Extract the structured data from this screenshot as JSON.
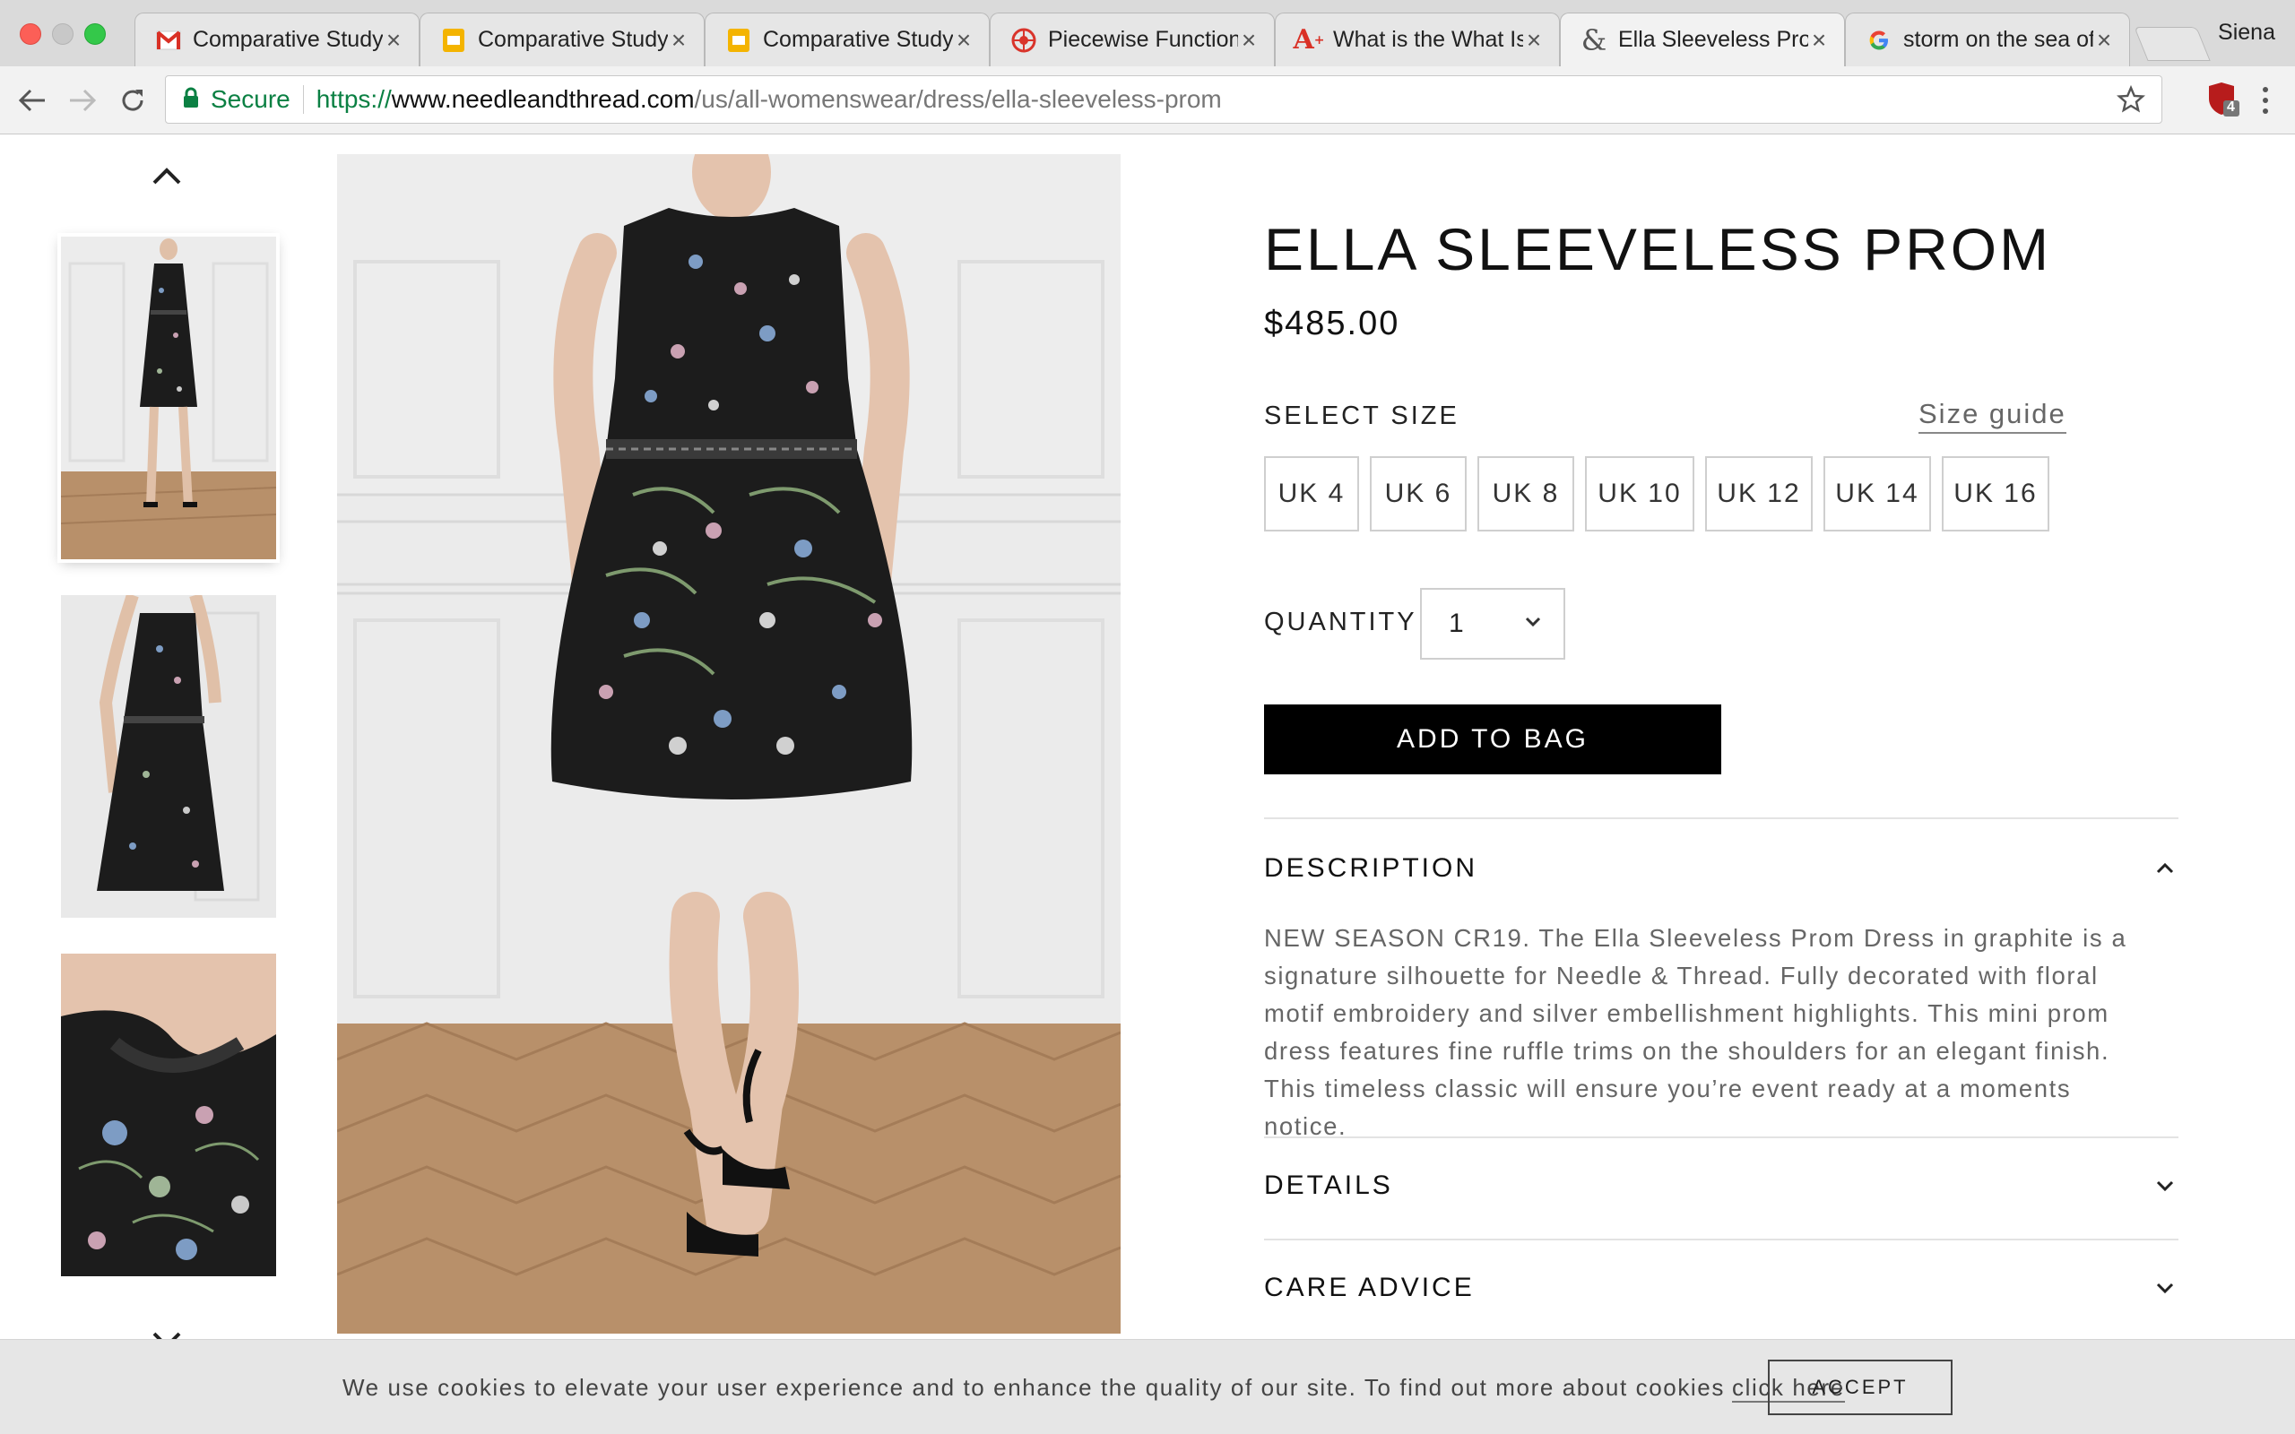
{
  "browser": {
    "profile_name": "Siena",
    "tabs": [
      {
        "title": "Comparative Study",
        "icon": "gmail-icon"
      },
      {
        "title": "Comparative Study",
        "icon": "google-slides-icon"
      },
      {
        "title": "Comparative Study",
        "icon": "google-slides-icon"
      },
      {
        "title": "Piecewise Function",
        "icon": "desmos-icon"
      },
      {
        "title": "What is the What Is",
        "icon": "a-plus-icon"
      },
      {
        "title": "Ella Sleeveless Prom",
        "icon": "ampersand-icon"
      },
      {
        "title": "storm on the sea of",
        "icon": "google-icon"
      }
    ],
    "active_tab": 5,
    "secure_label": "Secure",
    "url_scheme": "https://",
    "url_host": "www.needleandthread.com",
    "url_path": "/us/all-womenswear/dress/ella-sleeveless-prom",
    "extension_badge": "4"
  },
  "product": {
    "name": "ELLA SLEEVELESS PROM",
    "price": "$485.00",
    "select_size_label": "SELECT SIZE",
    "size_guide_label": "Size guide",
    "sizes": [
      "UK 4",
      "UK 6",
      "UK 8",
      "UK 10",
      "UK 12",
      "UK 14",
      "UK 16"
    ],
    "quantity_label": "QUANTITY",
    "quantity_value": "1",
    "add_to_bag_label": "ADD TO BAG",
    "accordions": [
      {
        "title": "DESCRIPTION",
        "expanded": true
      },
      {
        "title": "DETAILS",
        "expanded": false
      },
      {
        "title": "CARE ADVICE",
        "expanded": false
      }
    ],
    "description": "NEW SEASON CR19. The Ella Sleeveless Prom Dress in graphite is a signature silhouette for Needle & Thread. Fully decorated with floral motif embroidery and silver embellishment highlights. This mini prom dress features fine ruffle trims on the shoulders for an elegant finish. This timeless classic will ensure you’re event ready at a moments notice."
  },
  "cookie_bar": {
    "text": "We use cookies to elevate your user experience and to enhance the quality of our site. To find out more about cookies",
    "link_label": "click here",
    "accept_label": "ACCEPT"
  },
  "colors": {
    "secure_green": "#0b8043",
    "button_black": "#000000",
    "wall": "#ebebeb",
    "floor": "#b8906a",
    "dress": "#1c1c1c"
  }
}
